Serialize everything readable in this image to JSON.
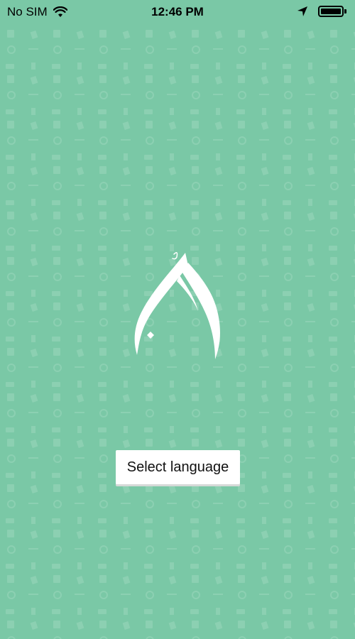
{
  "status_bar": {
    "carrier": "No SIM",
    "time": "12:46 PM",
    "wifi_icon": "wifi-icon",
    "location_icon": "location-arrow-icon",
    "battery_icon": "battery-icon",
    "battery_level": 1.0
  },
  "splash": {
    "logo_icon": "app-logo-calligraphy",
    "background_color": "#7ac8a6",
    "pattern_color": "#8fd1b4"
  },
  "actions": {
    "select_language_label": "Select language"
  }
}
